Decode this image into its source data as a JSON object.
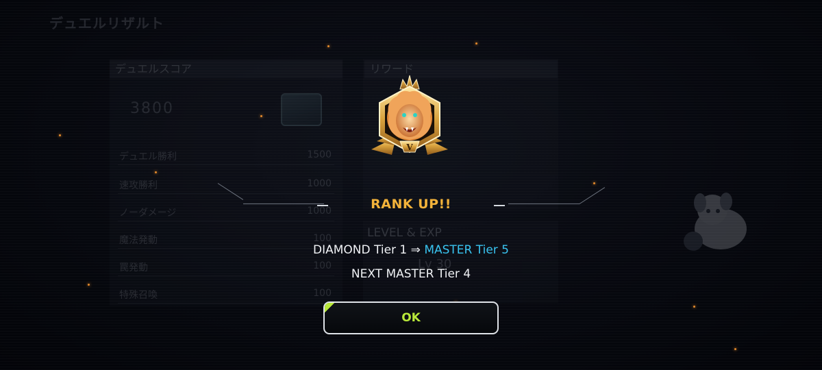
{
  "background": {
    "title": "デュエルリザルト",
    "score_panel": {
      "header": "デュエルスコア",
      "total": "3800",
      "rows": [
        {
          "label": "デュエル勝利",
          "value": "1500"
        },
        {
          "label": "速攻勝利",
          "value": "1000"
        },
        {
          "label": "ノーダメージ",
          "value": "1000"
        },
        {
          "label": "魔法発動",
          "value": "100"
        },
        {
          "label": "罠発動",
          "value": "100"
        },
        {
          "label": "特殊召喚",
          "value": "100"
        }
      ]
    },
    "reward_panel": {
      "header": "リワード"
    },
    "level_panel": {
      "header": "LEVEL & EXP",
      "level": "Lv 30"
    }
  },
  "dialog": {
    "emblem_icon": "master-lion-emblem-icon",
    "emblem_tier": "V",
    "title": "RANK UP!!",
    "from_rank": "DIAMOND Tier 1",
    "arrow": "⇒",
    "to_rank": "MASTER Tier 5",
    "next_rank": "NEXT MASTER Tier 4",
    "ok_label": "OK"
  },
  "colors": {
    "title_accent": "#f2b23a",
    "highlight_rank": "#39c4f0",
    "ok_text": "#b8e83a"
  }
}
